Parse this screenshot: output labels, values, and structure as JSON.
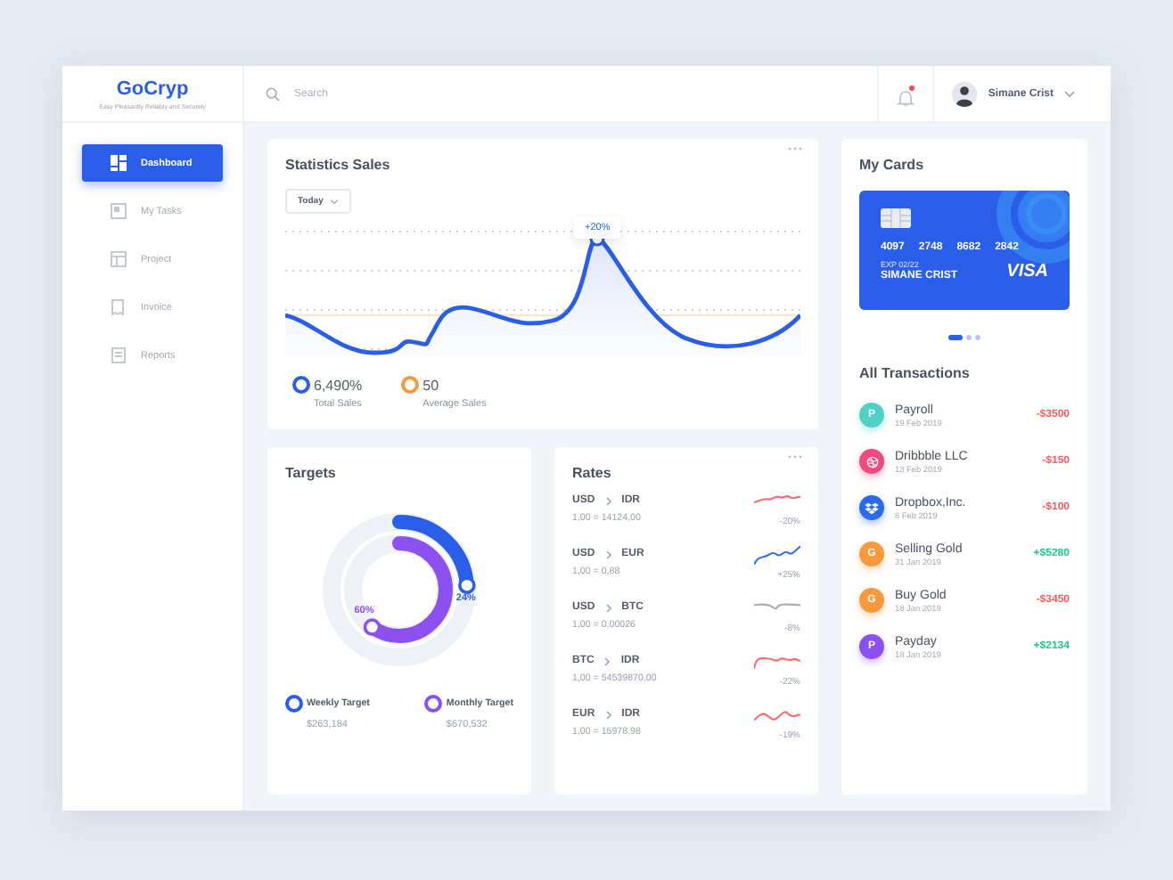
{
  "brand": {
    "name": "GoCryp",
    "tagline": "Easy Pleasantly Reliably and Securely"
  },
  "sidebar": {
    "items": [
      {
        "label": "Dashboard",
        "selected": true
      },
      {
        "label": "My Tasks",
        "selected": false
      },
      {
        "label": "Project",
        "selected": false
      },
      {
        "label": "Invoice",
        "selected": false
      },
      {
        "label": "Reports",
        "selected": false
      }
    ]
  },
  "header": {
    "search": {
      "placeholder": "Search"
    },
    "notifications": {
      "unread": true
    },
    "user": {
      "name": "Simane Crist"
    }
  },
  "statistics": {
    "title": "Statistics Sales",
    "period": "Today",
    "tooltip": "+20%",
    "legend": [
      {
        "value": "6,490%",
        "label": "Total Sales",
        "color": "#2a5ee8"
      },
      {
        "value": "50",
        "label": "Average Sales",
        "color": "#f79a3e"
      }
    ]
  },
  "targets": {
    "title": "Targets",
    "items": [
      {
        "name": "Weekly Target",
        "amount": "$263,184",
        "percent": "24%",
        "level": 0.24,
        "color": "#2a5ee8"
      },
      {
        "name": "Monthly Target",
        "amount": "$670,532",
        "percent": "60%",
        "level": 0.6,
        "color": "#8c4ff0"
      }
    ]
  },
  "rates": {
    "title": "Rates",
    "items": [
      {
        "from": "USD",
        "to": "IDR",
        "rate": "1,00 = 14124,00",
        "change": "-20%",
        "color": "#ff6b6b"
      },
      {
        "from": "USD",
        "to": "EUR",
        "rate": "1,00 = 0,88",
        "change": "+25%",
        "color": "#3c6ef0"
      },
      {
        "from": "USD",
        "to": "BTC",
        "rate": "1,00 = 0,00026",
        "change": "-8%",
        "color": "#a9adb8"
      },
      {
        "from": "BTC",
        "to": "IDR",
        "rate": "1,00 = 54539870,00",
        "change": "-22%",
        "color": "#ff6b6b"
      },
      {
        "from": "EUR",
        "to": "IDR",
        "rate": "1,00 = 15978,98",
        "change": "-19%",
        "color": "#ff6b6b"
      }
    ]
  },
  "cards": {
    "title": "My Cards",
    "card": {
      "number": [
        "4097",
        "2748",
        "8682",
        "2842"
      ],
      "expiry": "EXP 02/22",
      "holder": "SIMANE CRIST",
      "brand": "VISA"
    },
    "pages": [
      {
        "selected": true
      },
      {
        "selected": false
      },
      {
        "selected": false
      }
    ]
  },
  "transactions": {
    "title": "All Transactions",
    "items": [
      {
        "kind": "letter",
        "letter": "P",
        "color": "#4fd1c5",
        "name": "Payroll",
        "date": "19 Feb 2019",
        "amount": "-$3500",
        "incoming": false
      },
      {
        "kind": "ball",
        "color": "#f2497f",
        "name": "Dribbble LLC",
        "date": "13 Feb 2019",
        "amount": "-$150",
        "incoming": false
      },
      {
        "kind": "box",
        "color": "#2a6af0",
        "name": "Dropbox,Inc.",
        "date": "8 Feb 2019",
        "amount": "-$100",
        "incoming": false
      },
      {
        "kind": "letter",
        "letter": "G",
        "color": "#f79a3e",
        "name": "Selling Gold",
        "date": "31 Jan 2019",
        "amount": "+$5280",
        "incoming": true
      },
      {
        "kind": "letter",
        "letter": "G",
        "color": "#f79a3e",
        "name": "Buy Gold",
        "date": "18 Jan 2019",
        "amount": "-$3450",
        "incoming": false
      },
      {
        "kind": "letter",
        "letter": "P",
        "color": "#8c4ff0",
        "name": "Payday",
        "date": "18 Jan 2019",
        "amount": "+$2134",
        "incoming": true
      }
    ]
  }
}
